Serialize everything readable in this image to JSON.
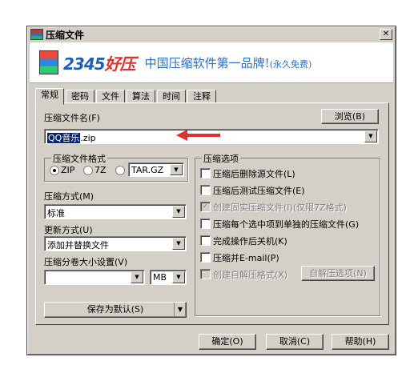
{
  "window": {
    "title": "压缩文件",
    "close_glyph": "✕"
  },
  "banner": {
    "brand_prefix": "2345",
    "brand_suffix": "好压",
    "slogan": "中国压缩软件第一品牌!",
    "slogan_note": "(永久免费)"
  },
  "tabs": [
    {
      "label": "常规"
    },
    {
      "label": "密码"
    },
    {
      "label": "文件"
    },
    {
      "label": "算法"
    },
    {
      "label": "时间"
    },
    {
      "label": "注释"
    }
  ],
  "general": {
    "filename_label": "压缩文件名(F)",
    "browse_label": "浏览(B)",
    "filename_selected": "QQ音乐",
    "filename_ext": ".zip",
    "format_group": "压缩文件格式",
    "format_options": [
      {
        "label": "ZIP",
        "checked": true
      },
      {
        "label": "7Z",
        "checked": false
      },
      {
        "label": "",
        "checked": false
      }
    ],
    "format_extra_value": "TAR.GZ",
    "method_label": "压缩方式(M)",
    "method_value": "标准",
    "update_label": "更新方式(U)",
    "update_value": "添加并替换文件",
    "split_label": "压缩分卷大小设置(V)",
    "split_value": "",
    "split_unit": "MB",
    "save_default_label": "保存为默认(S)",
    "options_group": "压缩选项",
    "options": [
      {
        "label": "压缩后删除源文件(L)",
        "checked": false,
        "disabled": false
      },
      {
        "label": "压缩后测试压缩文件(E)",
        "checked": false,
        "disabled": false
      },
      {
        "label": "创建固实压缩文件(I)(仅限7Z格式)",
        "checked": true,
        "disabled": true
      },
      {
        "label": "压缩每个选中项到单独的压缩文件(G)",
        "checked": false,
        "disabled": false
      },
      {
        "label": "完成操作后关机(K)",
        "checked": false,
        "disabled": false
      },
      {
        "label": "压缩并E-mail(P)",
        "checked": false,
        "disabled": false
      },
      {
        "label": "创建自解压格式(X)",
        "checked": false,
        "disabled": true
      }
    ],
    "sfx_options_label": "自解压选项(N)"
  },
  "footer": {
    "ok_label": "确定(O)",
    "cancel_label": "取消(C)",
    "help_label": "帮助(H)"
  },
  "colors": {
    "arrow": "#e0312a",
    "selection": "#0a246a"
  }
}
